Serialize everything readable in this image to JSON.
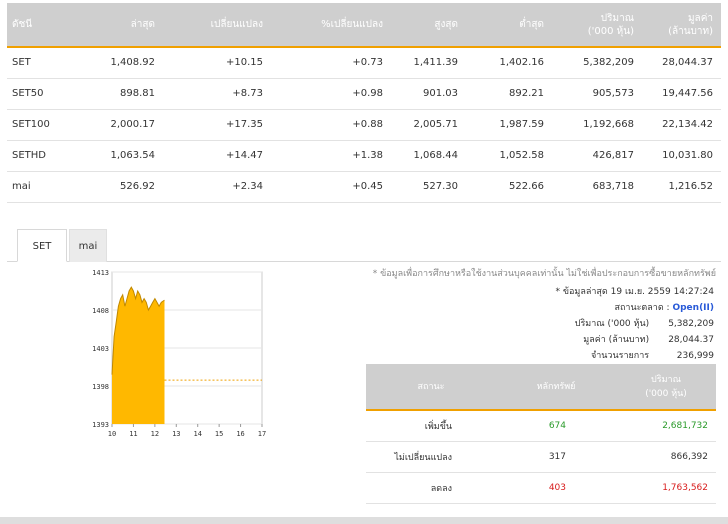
{
  "index_table": {
    "headers": [
      "ดัชนี",
      "ล่าสุด",
      "เปลี่ยนแปลง",
      "%เปลี่ยนแปลง",
      "สูงสุด",
      "ต่ำสุด",
      "ปริมาณ\n('000 หุ้น)",
      "มูลค่า\n(ล้านบาท)"
    ],
    "rows": [
      {
        "name": "SET",
        "last": "1,408.92",
        "change": "+10.15",
        "pct": "+0.73",
        "high": "1,411.39",
        "low": "1,402.16",
        "volume": "5,382,209",
        "value": "28,044.37"
      },
      {
        "name": "SET50",
        "last": "898.81",
        "change": "+8.73",
        "pct": "+0.98",
        "high": "901.03",
        "low": "892.21",
        "volume": "905,573",
        "value": "19,447.56"
      },
      {
        "name": "SET100",
        "last": "2,000.17",
        "change": "+17.35",
        "pct": "+0.88",
        "high": "2,005.71",
        "low": "1,987.59",
        "volume": "1,192,668",
        "value": "22,134.42"
      },
      {
        "name": "SETHD",
        "last": "1,063.54",
        "change": "+14.47",
        "pct": "+1.38",
        "high": "1,068.44",
        "low": "1,052.58",
        "volume": "426,817",
        "value": "10,031.80"
      },
      {
        "name": "mai",
        "last": "526.92",
        "change": "+2.34",
        "pct": "+0.45",
        "high": "527.30",
        "low": "522.66",
        "volume": "683,718",
        "value": "1,216.52"
      }
    ]
  },
  "tabs": [
    "SET",
    "mai"
  ],
  "disclaimer": "* ข้อมูลเพื่อการศึกษาหรือใช้งานส่วนบุคคลเท่านั้น ไม่ใช่เพื่อประกอบการซื้อขายหลักทรัพย์",
  "market_info": {
    "updated_label": "* ข้อมูลล่าสุด 19 เม.ย. 2559 14:27:24",
    "status_label": "สถานะตลาด :",
    "status_value": "Open(II)",
    "volume_label": "ปริมาณ ('000 หุ้น)",
    "volume_value": "5,382,209",
    "value_label": "มูลค่า (ล้านบาท)",
    "value_value": "28,044.37",
    "trades_label": "จำนวนรายการ",
    "trades_value": "236,999"
  },
  "stat_table": {
    "headers": [
      "สถานะ",
      "หลักทรัพย์",
      "ปริมาณ\n('000 หุ้น)"
    ],
    "rows": [
      {
        "status": "เพิ่มขึ้น",
        "count": "674",
        "volume": "2,681,732"
      },
      {
        "status": "ไม่เปลี่ยนแปลง",
        "count": "317",
        "volume": "866,392"
      },
      {
        "status": "ลดลง",
        "count": "403",
        "volume": "1,763,562"
      }
    ]
  },
  "chart_data": {
    "type": "area",
    "y_ticks": [
      "1413",
      "1408",
      "1403",
      "1398",
      "1393"
    ],
    "x_ticks": [
      "10",
      "11",
      "12",
      "13",
      "14",
      "15",
      "16",
      "17"
    ],
    "ylim": [
      1393,
      1413
    ],
    "xlim": [
      10,
      17
    ],
    "prev_close": 1398.77,
    "x": [
      10.0,
      10.1,
      10.2,
      10.3,
      10.4,
      10.5,
      10.6,
      10.7,
      10.8,
      10.9,
      11.0,
      11.1,
      11.2,
      11.3,
      11.4,
      11.5,
      11.6,
      11.7,
      11.8,
      11.9,
      12.0,
      12.1,
      12.2,
      12.3,
      12.45
    ],
    "values": [
      1399.5,
      1404.5,
      1406.5,
      1408.5,
      1409.5,
      1410.0,
      1408.5,
      1409.5,
      1410.5,
      1411.0,
      1410.5,
      1409.5,
      1410.5,
      1410.0,
      1409.0,
      1409.5,
      1409.0,
      1408.0,
      1408.5,
      1409.0,
      1409.5,
      1409.0,
      1408.5,
      1409.0,
      1409.3
    ],
    "fill_color": "#ffb800",
    "line_color": "#c08800",
    "ref_line_color": "#f0a000"
  }
}
